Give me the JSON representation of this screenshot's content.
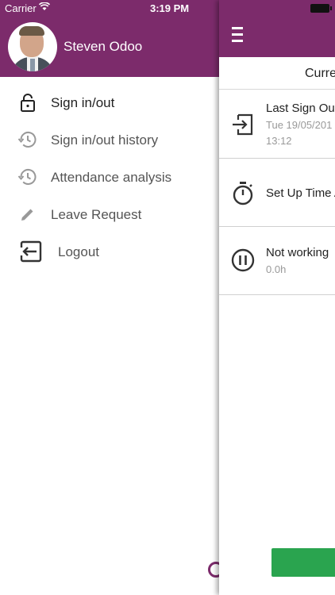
{
  "status_bar": {
    "carrier": "Carrier",
    "time": "3:19 PM"
  },
  "drawer": {
    "user_name": "Steven Odoo",
    "items": [
      {
        "label": "Sign in/out",
        "icon": "lock-icon",
        "active": true
      },
      {
        "label": "Sign in/out history",
        "icon": "history-icon"
      },
      {
        "label": "Attendance analysis",
        "icon": "history-icon"
      },
      {
        "label": "Leave Request",
        "icon": "pencil-icon"
      },
      {
        "label": "Logout",
        "icon": "logout-icon"
      }
    ]
  },
  "main": {
    "title": "Curre",
    "cards": [
      {
        "title": "Last Sign Ou",
        "sub1": "Tue 19/05/201",
        "sub2": "13:12",
        "icon": "sign-in-arrow-icon"
      },
      {
        "title": "Set Up Time A",
        "icon": "stopwatch-icon"
      },
      {
        "title": "Not working",
        "sub1": "0.0h",
        "icon": "pause-icon"
      }
    ]
  },
  "colors": {
    "brand": "#7c2b6b",
    "action": "#2aa44f"
  }
}
